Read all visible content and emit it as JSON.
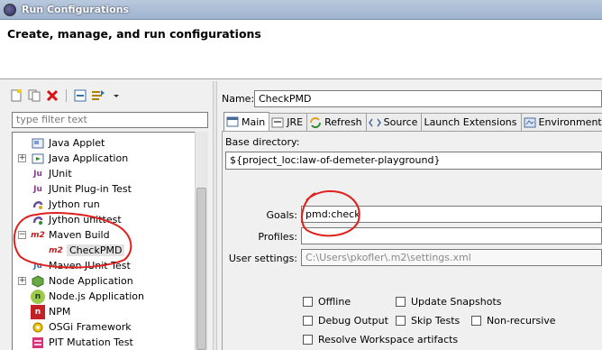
{
  "window": {
    "title": "Run Configurations"
  },
  "header": {
    "description": "Create, manage, and run configurations"
  },
  "left": {
    "filter_placeholder": "type filter text",
    "tree": [
      {
        "label": "Java Applet",
        "icon": "java-applet-icon"
      },
      {
        "label": "Java Application",
        "icon": "java-application-icon",
        "expander": "+"
      },
      {
        "label": "JUnit",
        "icon": "junit-icon",
        "icon_text": "Ju"
      },
      {
        "label": "JUnit Plug-in Test",
        "icon": "junit-plugin-icon",
        "icon_text": "Ju"
      },
      {
        "label": "Jython run",
        "icon": "jython-run-icon"
      },
      {
        "label": "Jython unittest",
        "icon": "jython-unittest-icon"
      },
      {
        "label": "Maven Build",
        "icon": "maven-build-icon",
        "icon_text": "m2",
        "expander": "−"
      },
      {
        "label": "CheckPMD",
        "icon": "maven-config-icon",
        "icon_text": "m2",
        "selected": true
      },
      {
        "label": "Maven JUnit Test",
        "icon": "maven-junit-icon",
        "icon_text": "Ju"
      },
      {
        "label": "Node Application",
        "icon": "node-application-icon",
        "expander": "+"
      },
      {
        "label": "Node.js Application",
        "icon": "nodejs-icon",
        "icon_text": "n"
      },
      {
        "label": "NPM",
        "icon": "npm-icon",
        "icon_text": "n"
      },
      {
        "label": "OSGi Framework",
        "icon": "osgi-icon"
      },
      {
        "label": "PIT Mutation Test",
        "icon": "pit-icon"
      }
    ]
  },
  "right": {
    "name_label": "Name:",
    "name_value": "CheckPMD",
    "tabs": [
      {
        "label": "Main",
        "icon": "main-tab-icon",
        "active": true
      },
      {
        "label": "JRE",
        "icon": "jre-icon"
      },
      {
        "label": "Refresh",
        "icon": "refresh-icon"
      },
      {
        "label": "Source",
        "icon": "source-icon"
      },
      {
        "label": "Launch Extensions",
        "icon": "launch-extensions-icon"
      },
      {
        "label": "Environment",
        "icon": "environment-icon"
      }
    ],
    "base_dir_label": "Base directory:",
    "base_dir_value": "${project_loc:law-of-demeter-playground}",
    "goals_label": "Goals:",
    "goals_value": "pmd:check",
    "profiles_label": "Profiles:",
    "profiles_value": "",
    "user_settings_label": "User settings:",
    "user_settings_value": "C:\\Users\\pkofler\\.m2\\settings.xml",
    "checkboxes": {
      "offline": "Offline",
      "update_snapshots": "Update Snapshots",
      "debug_output": "Debug Output",
      "skip_tests": "Skip Tests",
      "non_recursive": "Non-recursive",
      "resolve_workspace": "Resolve Workspace artifacts"
    }
  },
  "colors": {
    "annotation": "#e0201c",
    "selection": "#e2e2e2",
    "maven_red": "#c0201e"
  }
}
